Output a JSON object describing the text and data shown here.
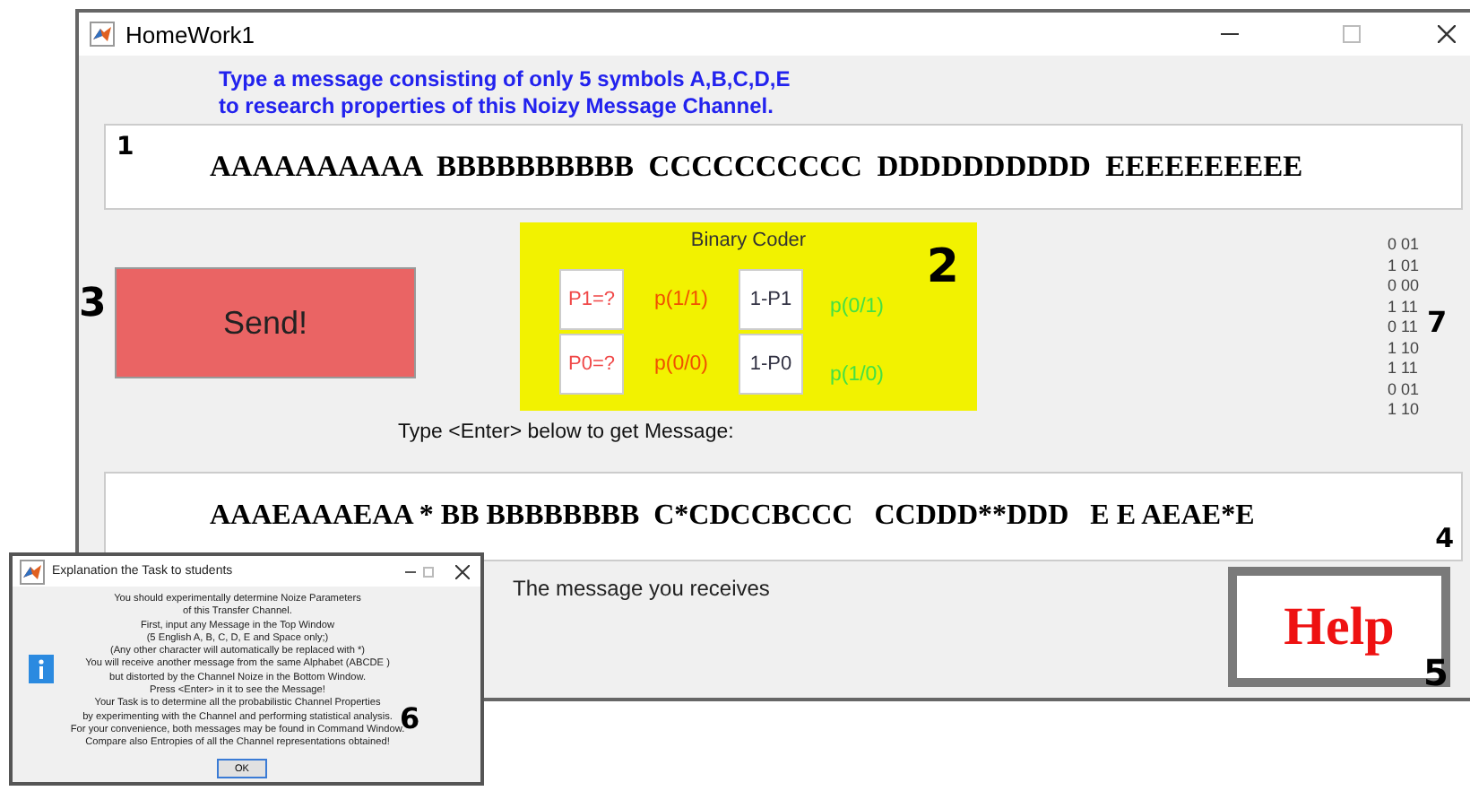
{
  "window": {
    "title": "HomeWork1"
  },
  "instructions": [
    "Type a message consisting of only 5 symbols A,B,C,D,E",
    "to research properties of this Noizy Message Channel."
  ],
  "input_box": {
    "marker": "1",
    "value": "AAAAAAAAAA  BBBBBBBBBB  CCCCCCCCCC  DDDDDDDDDD  EEEEEEEEEE"
  },
  "send_button": {
    "label": "Send!",
    "marker": "3"
  },
  "binary_coder": {
    "title": "Binary Coder",
    "marker": "2",
    "rows": [
      {
        "cells": [
          {
            "kind": "box",
            "text": "P1=?",
            "color": "#f04848"
          },
          {
            "kind": "label",
            "text": "p(1/1)",
            "color": "#f05000"
          },
          {
            "kind": "box",
            "text": "1-P1",
            "color": "#333344"
          },
          {
            "kind": "label",
            "text": "p(0/1)",
            "color": "#44e044"
          }
        ]
      },
      {
        "cells": [
          {
            "kind": "box",
            "text": "P0=?",
            "color": "#f04848"
          },
          {
            "kind": "label",
            "text": "p(0/0)",
            "color": "#f05000"
          },
          {
            "kind": "box",
            "text": "1-P0",
            "color": "#333344"
          },
          {
            "kind": "label",
            "text": "p(1/0)",
            "color": "#44e044"
          }
        ]
      }
    ]
  },
  "bit_list": {
    "marker": "7",
    "items": [
      "0 01",
      "1 01",
      "0 00",
      "1 11",
      "0 11",
      "1 10",
      "1 11",
      "0 01",
      "1 10"
    ]
  },
  "enter_hint": "Type <Enter> below to get Message:",
  "output_box": {
    "marker": "4",
    "value": "AAAEAAAEAA * BB BBBBBBBB  C*CDCCBCCC   CCDDD**DDD   E E AEAE*E"
  },
  "output_caption": "The message you receives",
  "help_button": {
    "label": "Help",
    "marker": "5"
  },
  "dialog": {
    "title": "Explanation the Task to students",
    "marker": "6",
    "lines": [
      "You should experimentally determine Noize Parameters",
      "of this Transfer Channel.",
      "First, input any Message in the Top Window",
      "(5 English A, B, C, D, E and Space only;)",
      "(Any other character will automatically be replaced with *)",
      "You will receive another message from the same Alphabet (ABCDE )",
      "but distorted by the Channel Noize in the Bottom Window.",
      "Press <Enter> in it to see the Message!",
      "Your Task is to determine all the probabilistic Channel Properties",
      "by experimenting with the Channel and performing statistical analysis.",
      "For your convenience, both messages may be found in Command Window.",
      "Compare also Entropies of all the Channel representations obtained!"
    ],
    "button": "OK"
  }
}
